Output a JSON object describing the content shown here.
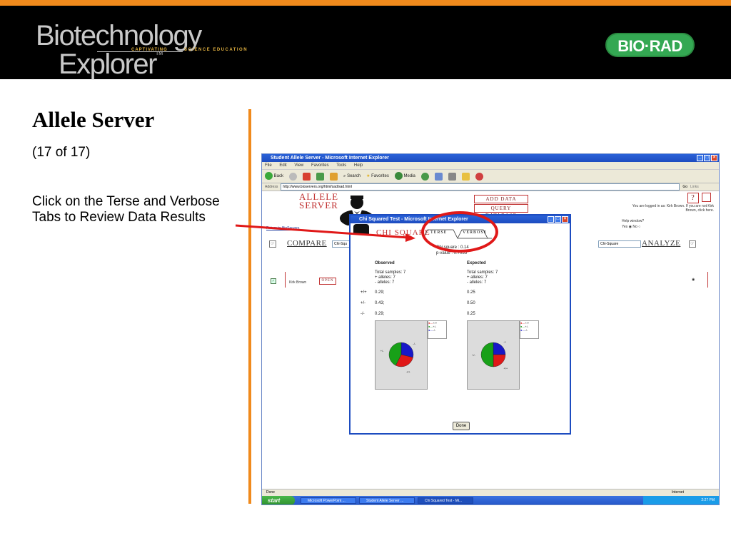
{
  "slide": {
    "title": "Allele Server",
    "subtitle": "(17 of 17)",
    "body": "Click on the Terse and Verbose Tabs to Review Data Results"
  },
  "branding": {
    "left_logo_line1": "Biotechnology",
    "left_logo_line2": "Explorer",
    "left_logo_tm": "TM",
    "left_logo_tag1": "CAPTIVATING",
    "left_logo_tag2": "SCIENCE EDUCATION",
    "right_logo": "BIO·RAD",
    "accent_color": "#f08a1c"
  },
  "browser": {
    "title": "Student Allele Server - Microsoft Internet Explorer",
    "menu": [
      "File",
      "Edit",
      "View",
      "Favorites",
      "Tools",
      "Help"
    ],
    "toolbar": {
      "back": "Back",
      "search": "Search",
      "favorites": "Favorites",
      "media": "Media"
    },
    "address_label": "Address",
    "address": "http://www.bioservers.org/html/sad/sad.html",
    "go": "Go",
    "links": "Links",
    "status": "Done",
    "zone": "Internet"
  },
  "page": {
    "logo_line1": "ALLELE",
    "logo_line2": "SERVER",
    "add_data": "ADD DATA",
    "query_database": "QUERY DATABASE",
    "return_link": "Return to BioServers",
    "logged_in": "You are logged in as: Kirk Brown. If you are not Kirk Brown, click here.",
    "help_window": "Help window?",
    "help_yes": "Yes",
    "help_no": "No",
    "compare": "COMPARE",
    "compare_select": "Chi-Squ",
    "analyze": "ANALYZE",
    "analyze_select": "Chi-Square",
    "row_name": "Kirk Brown",
    "open": "OPEN",
    "help_q": "?"
  },
  "dialog": {
    "title": "Chi Squared Test - Microsoft Internet Explorer",
    "heading": "CHI SQUARE",
    "tab_terse": "TERSE",
    "tab_verbose": "VERBOSE",
    "chi_square": "Chi square : 0.14",
    "p_value": "p-value : 0.7055",
    "observed": {
      "heading": "Observed",
      "total": "Total samples: 7",
      "plus": "+ alleles: 7",
      "minus": "- alleles: 7",
      "pp": "0.29;",
      "pm": "0.43;",
      "mm": "0.29;"
    },
    "expected": {
      "heading": "Expected",
      "total": "Total samples: 7",
      "plus": "+ alleles: 7",
      "minus": "- alleles: 7",
      "pp": "0.25",
      "pm": "0.50",
      "mm": "0.25"
    },
    "genotypes": [
      "+/+",
      "+/-",
      "-/-"
    ],
    "legend": [
      "+/+",
      "+/-",
      "-/-"
    ],
    "colors": {
      "pp": "#e01818",
      "pm": "#18a018",
      "mm": "#1818c8"
    },
    "observed_shares": [
      0.29,
      0.43,
      0.29
    ],
    "expected_shares": [
      0.25,
      0.5,
      0.25
    ],
    "done": "Done"
  },
  "taskbar": {
    "start": "start",
    "tasks": [
      "Microsoft PowerPoint ...",
      "Student Allele Server ...",
      "Chi Squared Test - Mi..."
    ],
    "clock": "2:27 PM"
  }
}
